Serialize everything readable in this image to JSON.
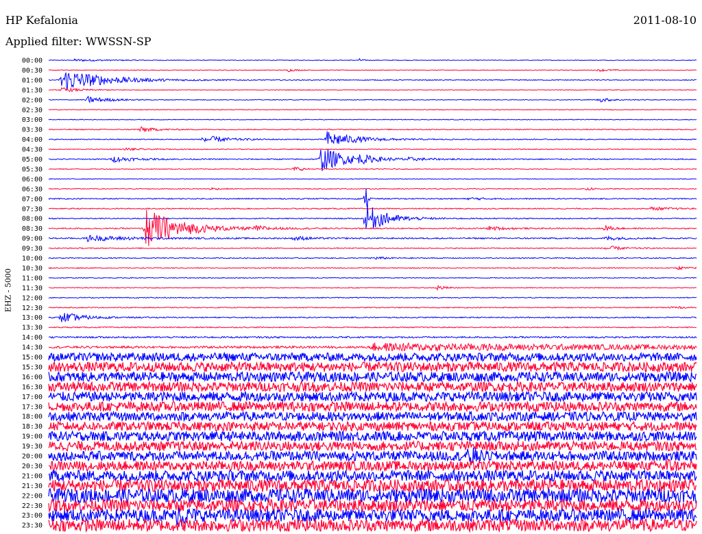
{
  "header": {
    "station": "HP Kefalonia",
    "date": "2011-08-10",
    "filter_label": "Applied filter: WWSSN-SP"
  },
  "chart_data": {
    "type": "line",
    "title": "HP Kefalonia",
    "date": "2011-08-10",
    "subtitle": "Applied filter: WWSSN-SP",
    "ylabel": "EHZ - 5000",
    "xlabel": "",
    "row_labels": [
      "00:00",
      "00:30",
      "01:00",
      "01:30",
      "02:00",
      "02:30",
      "03:00",
      "03:30",
      "04:00",
      "04:30",
      "05:00",
      "05:30",
      "06:00",
      "06:30",
      "07:00",
      "07:30",
      "08:00",
      "08:30",
      "09:00",
      "09:30",
      "10:00",
      "10:30",
      "11:00",
      "11:30",
      "12:00",
      "12:30",
      "13:00",
      "13:30",
      "14:00",
      "14:30",
      "15:00",
      "15:30",
      "16:00",
      "16:30",
      "17:00",
      "17:30",
      "18:00",
      "18:30",
      "19:00",
      "19:30",
      "20:00",
      "20:30",
      "21:00",
      "21:30",
      "22:00",
      "22:30",
      "23:00",
      "23:30"
    ],
    "row_duration_minutes": 30,
    "colors": {
      "even_rows": "#0000ff",
      "odd_rows": "#ff0033"
    },
    "rows": [
      {
        "label": "00:00",
        "noise": 0.5,
        "events": [
          {
            "t": 0.04,
            "amp": 1.5,
            "dur": 0.05
          },
          {
            "t": 0.48,
            "amp": 2,
            "dur": 0.005
          }
        ]
      },
      {
        "label": "00:30",
        "noise": 0.5,
        "events": [
          {
            "t": 0.37,
            "amp": 2,
            "dur": 0.01
          },
          {
            "t": 0.85,
            "amp": 1.5,
            "dur": 0.02
          }
        ]
      },
      {
        "label": "01:00",
        "noise": 0.6,
        "events": [
          {
            "t": 0.02,
            "amp": 18,
            "dur": 0.06
          }
        ]
      },
      {
        "label": "01:30",
        "noise": 0.5,
        "events": [
          {
            "t": 0.02,
            "amp": 3,
            "dur": 0.03
          }
        ]
      },
      {
        "label": "02:00",
        "noise": 0.5,
        "events": [
          {
            "t": 0.06,
            "amp": 5,
            "dur": 0.03
          },
          {
            "t": 0.85,
            "amp": 3,
            "dur": 0.02
          }
        ]
      },
      {
        "label": "02:30",
        "noise": 0.5,
        "events": []
      },
      {
        "label": "03:00",
        "noise": 0.5,
        "events": []
      },
      {
        "label": "03:30",
        "noise": 0.7,
        "events": [
          {
            "t": 0.14,
            "amp": 4,
            "dur": 0.02
          }
        ]
      },
      {
        "label": "04:00",
        "noise": 0.7,
        "events": [
          {
            "t": 0.24,
            "amp": 6,
            "dur": 0.03
          },
          {
            "t": 0.43,
            "amp": 12,
            "dur": 0.04
          }
        ]
      },
      {
        "label": "04:30",
        "noise": 0.6,
        "events": [
          {
            "t": 0.12,
            "amp": 2,
            "dur": 0.02
          }
        ]
      },
      {
        "label": "05:00",
        "noise": 0.8,
        "events": [
          {
            "t": 0.1,
            "amp": 4,
            "dur": 0.03
          },
          {
            "t": 0.42,
            "amp": 18,
            "dur": 0.04
          },
          {
            "t": 0.48,
            "amp": 4,
            "dur": 0.02
          },
          {
            "t": 0.55,
            "amp": 2,
            "dur": 0.03
          }
        ]
      },
      {
        "label": "05:30",
        "noise": 0.6,
        "events": [
          {
            "t": 0.38,
            "amp": 4,
            "dur": 0.01
          }
        ]
      },
      {
        "label": "06:00",
        "noise": 0.5,
        "events": []
      },
      {
        "label": "06:30",
        "noise": 0.6,
        "events": [
          {
            "t": 0.25,
            "amp": 2,
            "dur": 0.01
          },
          {
            "t": 0.83,
            "amp": 3,
            "dur": 0.01
          }
        ]
      },
      {
        "label": "07:00",
        "noise": 0.8,
        "events": [
          {
            "t": 0.49,
            "amp": 20,
            "dur": 0.003
          },
          {
            "t": 0.65,
            "amp": 2,
            "dur": 0.02
          }
        ]
      },
      {
        "label": "07:30",
        "noise": 0.8,
        "events": [
          {
            "t": 0.93,
            "amp": 2,
            "dur": 0.03
          }
        ]
      },
      {
        "label": "08:00",
        "noise": 0.8,
        "events": [
          {
            "t": 0.49,
            "amp": 22,
            "dur": 0.03
          }
        ]
      },
      {
        "label": "08:30",
        "noise": 0.9,
        "events": [
          {
            "t": 0.15,
            "amp": 30,
            "dur": 0.05
          },
          {
            "t": 0.32,
            "amp": 3,
            "dur": 0.02
          },
          {
            "t": 0.68,
            "amp": 3,
            "dur": 0.02
          },
          {
            "t": 0.86,
            "amp": 5,
            "dur": 0.01
          }
        ]
      },
      {
        "label": "09:00",
        "noise": 1,
        "events": [
          {
            "t": 0.06,
            "amp": 4,
            "dur": 0.06
          },
          {
            "t": 0.38,
            "amp": 3,
            "dur": 0.02
          },
          {
            "t": 0.86,
            "amp": 3,
            "dur": 0.02
          }
        ]
      },
      {
        "label": "09:30",
        "noise": 0.7,
        "events": [
          {
            "t": 0.86,
            "amp": 4,
            "dur": 0.02
          }
        ]
      },
      {
        "label": "10:00",
        "noise": 0.7,
        "events": [
          {
            "t": 0.5,
            "amp": 2,
            "dur": 0.02
          }
        ]
      },
      {
        "label": "10:30",
        "noise": 0.7,
        "events": [
          {
            "t": 0.97,
            "amp": 2,
            "dur": 0.02
          }
        ]
      },
      {
        "label": "11:00",
        "noise": 0.6,
        "events": []
      },
      {
        "label": "11:30",
        "noise": 0.6,
        "events": [
          {
            "t": 0.6,
            "amp": 4,
            "dur": 0.01
          }
        ]
      },
      {
        "label": "12:00",
        "noise": 0.7,
        "events": []
      },
      {
        "label": "12:30",
        "noise": 0.7,
        "events": [
          {
            "t": 0.96,
            "amp": 3,
            "dur": 0.01
          }
        ]
      },
      {
        "label": "13:00",
        "noise": 0.8,
        "events": [
          {
            "t": 0.02,
            "amp": 8,
            "dur": 0.03
          }
        ]
      },
      {
        "label": "13:30",
        "noise": 0.8,
        "events": []
      },
      {
        "label": "14:00",
        "noise": 1.2,
        "events": []
      },
      {
        "label": "14:30",
        "noise": 1.6,
        "events": [
          {
            "t": 0.5,
            "amp": 5,
            "dur": 0.5
          }
        ]
      },
      {
        "label": "15:00",
        "noise": 6,
        "events": []
      },
      {
        "label": "15:30",
        "noise": 7,
        "events": []
      },
      {
        "label": "16:00",
        "noise": 7,
        "events": []
      },
      {
        "label": "16:30",
        "noise": 7,
        "events": []
      },
      {
        "label": "17:00",
        "noise": 7,
        "events": []
      },
      {
        "label": "17:30",
        "noise": 7,
        "events": []
      },
      {
        "label": "18:00",
        "noise": 6.5,
        "events": []
      },
      {
        "label": "18:30",
        "noise": 6.5,
        "events": []
      },
      {
        "label": "19:00",
        "noise": 7,
        "events": []
      },
      {
        "label": "19:30",
        "noise": 7,
        "events": []
      },
      {
        "label": "20:00",
        "noise": 7,
        "events": [
          {
            "t": 0.65,
            "amp": 12,
            "dur": 0.01
          }
        ]
      },
      {
        "label": "20:30",
        "noise": 7,
        "events": [
          {
            "t": 0.95,
            "amp": 10,
            "dur": 0.01
          }
        ]
      },
      {
        "label": "21:00",
        "noise": 8,
        "events": []
      },
      {
        "label": "21:30",
        "noise": 9,
        "events": []
      },
      {
        "label": "22:00",
        "noise": 10,
        "events": []
      },
      {
        "label": "22:30",
        "noise": 9,
        "events": []
      },
      {
        "label": "23:00",
        "noise": 9,
        "events": [
          {
            "t": 0.2,
            "amp": 18,
            "dur": 0.01
          }
        ]
      },
      {
        "label": "23:30",
        "noise": 9,
        "events": []
      }
    ]
  }
}
